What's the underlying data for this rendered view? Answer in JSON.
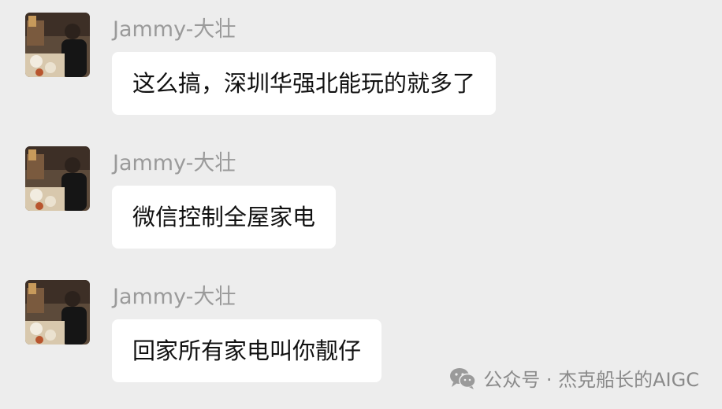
{
  "messages": [
    {
      "sender": "Jammy-大壮",
      "text": "这么搞，深圳华强北能玩的就多了"
    },
    {
      "sender": "Jammy-大壮",
      "text": "微信控制全屋家电"
    },
    {
      "sender": "Jammy-大壮",
      "text": "回家所有家电叫你靓仔"
    }
  ],
  "watermark": {
    "icon": "wechat-icon",
    "text": "公众号 · 杰克船长的AIGC"
  },
  "colors": {
    "background": "#ededed",
    "bubble": "#ffffff",
    "sender_name": "#9a9a9a",
    "message_text": "#111111"
  }
}
